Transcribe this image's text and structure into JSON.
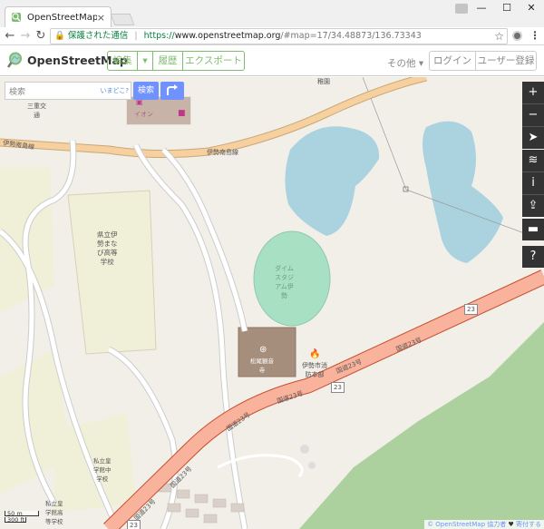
{
  "browser": {
    "tab_title": "OpenStreetMap",
    "tab_close": "×",
    "win_min": "—",
    "win_max": "☐",
    "win_close": "✕",
    "secure_label": "保護された通信",
    "url_scheme": "https://",
    "url_host": "www.openstreetmap.org",
    "url_path": "/#map=17/34.48873/136.73343"
  },
  "osm": {
    "brand": "OpenStreetMap",
    "nav": {
      "edit": "編集",
      "history": "履歴",
      "export": "エクスポート"
    },
    "more": "その他",
    "login": "ログイン",
    "signup": "ユーザー登録",
    "search": {
      "placeholder": "検索",
      "where_am_i": "いまどこ?",
      "go": "検索"
    },
    "attribution": {
      "credit": "© OpenStreetMap 協力者",
      "donate": "寄付する"
    }
  },
  "map": {
    "labels": {
      "road_name_ise_minami": "伊勢南島線",
      "road_name_ise_minami_2": "伊勢南島線",
      "school": "県立伊\n勢まな\nび高等\n学校",
      "dam": "ダイム\nスタジ\nアム伊\n勢",
      "temple": "松尾観音\n寺",
      "fire": "伊勢市消\n防本部",
      "aeon": "イオン",
      "misegawa_a": "三重交\n通",
      "private_school": "私立皇\n学館中\n学校",
      "private_school_2": "私立皇\n学館高\n等学校",
      "village": "稚園",
      "route_no_1": "国道23号",
      "route_no_2": "国道23号",
      "route_no_3": "国道23号",
      "route_no_4": "国道23号",
      "route_no_5": "国道23号",
      "route_no_6": "国道23号",
      "route_shield": "23"
    },
    "scale": {
      "metric": "50 m",
      "imperial": "300 ft"
    }
  },
  "colors": {
    "osm_green": "#7ebc6f",
    "water": "#aad3df",
    "park": "#add19e",
    "stadium": "#a8e0c3",
    "trunk_road": "#f9b29c",
    "secondary_road": "#f7d09f",
    "building": "#a58f7c"
  },
  "icons": {
    "logo": "osm-magnifier-logo",
    "favicon": "osm-favicon",
    "directions": "directions-icon",
    "zoom_in": "zoom-in-icon",
    "zoom_out": "zoom-out-icon",
    "locate": "locate-icon",
    "layers": "layers-icon",
    "info": "info-icon",
    "share": "share-icon",
    "note": "note-icon",
    "query": "query-icon"
  }
}
